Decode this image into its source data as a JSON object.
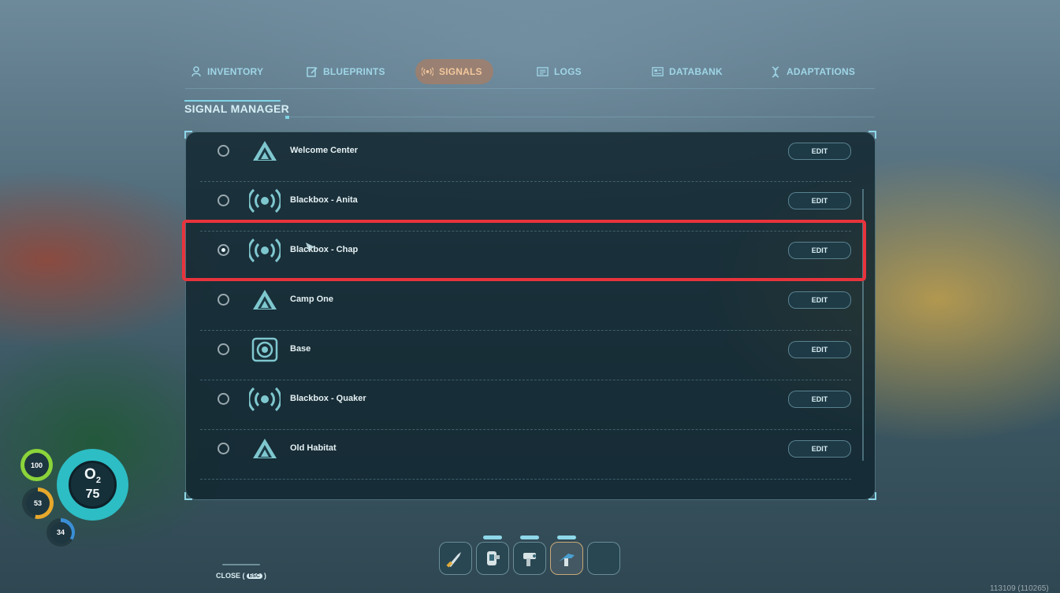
{
  "tabs": [
    {
      "label": "INVENTORY",
      "icon": "person-icon"
    },
    {
      "label": "BLUEPRINTS",
      "icon": "blueprint-icon"
    },
    {
      "label": "SIGNALS",
      "icon": "signal-icon",
      "active": true
    },
    {
      "label": "LOGS",
      "icon": "logs-icon"
    },
    {
      "label": "DATABANK",
      "icon": "databank-icon"
    },
    {
      "label": "ADAPTATIONS",
      "icon": "dna-icon"
    }
  ],
  "section_title": "SIGNAL MANAGER",
  "signals": [
    {
      "name": "Welcome Center",
      "icon": "triangle-beacon-icon",
      "selected": false,
      "edit_label": "EDIT"
    },
    {
      "name": "Blackbox - Anita",
      "icon": "broadcast-icon",
      "selected": false,
      "edit_label": "EDIT"
    },
    {
      "name": "Blackbox - Chap",
      "icon": "broadcast-icon",
      "selected": true,
      "edit_label": "EDIT"
    },
    {
      "name": "Camp One",
      "icon": "triangle-beacon-icon",
      "selected": false,
      "edit_label": "EDIT"
    },
    {
      "name": "Base",
      "icon": "base-icon",
      "selected": false,
      "edit_label": "EDIT"
    },
    {
      "name": "Blackbox - Quaker",
      "icon": "broadcast-icon",
      "selected": false,
      "edit_label": "EDIT"
    },
    {
      "name": "Old Habitat",
      "icon": "triangle-beacon-icon",
      "selected": false,
      "edit_label": "EDIT"
    }
  ],
  "vitals": {
    "oxygen_label": "O",
    "oxygen_sub": "2",
    "oxygen_value": "75",
    "health": "100",
    "food": "53",
    "water": "34"
  },
  "hotbar": {
    "slots": [
      "survival-knife-icon",
      "scanner-icon",
      "repair-tool-icon",
      "builder-icon",
      "empty-slot"
    ],
    "active_index": 3
  },
  "close": {
    "label": "CLOSE (",
    "key": "ESC",
    "end": ")"
  },
  "version": "113109 (110265)",
  "colors": {
    "accent": "#7fd3e6",
    "active_tab": "#c08050",
    "highlight": "#e8333c",
    "oxygen": "#2dbdc4",
    "health": "#8bd43a",
    "food": "#e7a82c",
    "water": "#3a8fd6"
  }
}
